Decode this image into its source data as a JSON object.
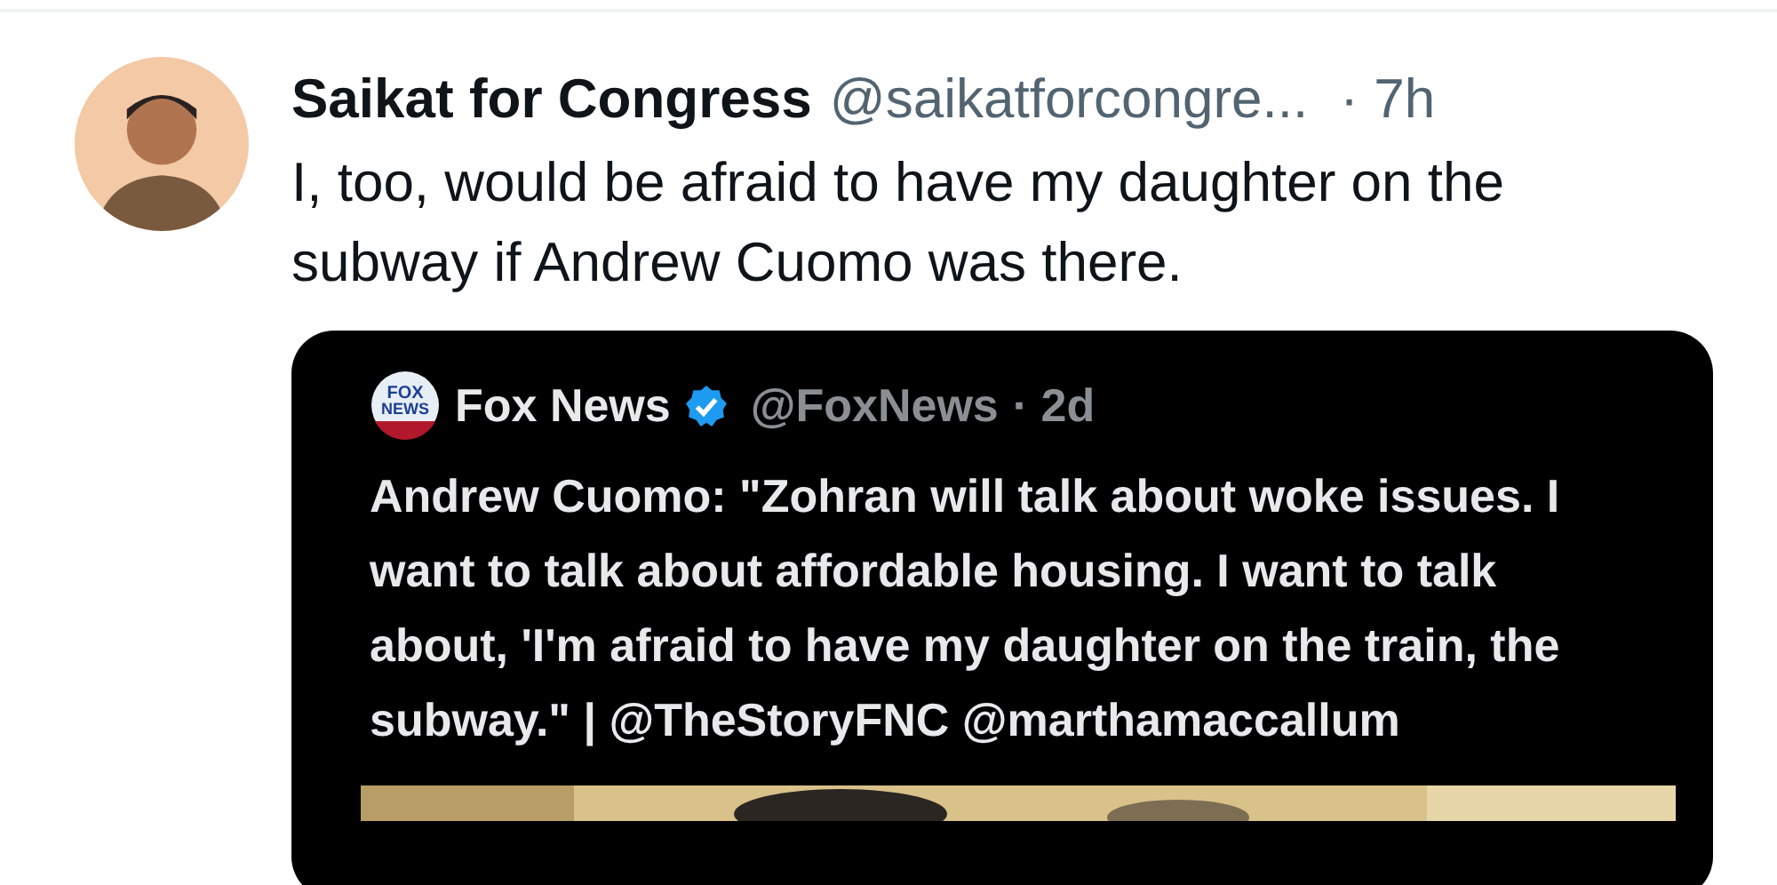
{
  "post": {
    "author": "Saikat for Congress",
    "handle": "@saikatforcongre...",
    "time": "· 7h",
    "text": "I, too, would be afraid to have my daughter on the subway if Andrew Cuomo was there."
  },
  "quoted_post": {
    "logo_text": [
      "FOX",
      "NEWS"
    ],
    "author": "Fox News",
    "verified": true,
    "handle": "@FoxNews",
    "time": "· 2d",
    "text": "Andrew Cuomo: \"Zohran will talk about woke issues. I want to talk about affordable housing. I want to talk about, 'I'm afraid to have my daughter on the train, the subway.\" | @TheStoryFNC @marthamaccallum"
  }
}
